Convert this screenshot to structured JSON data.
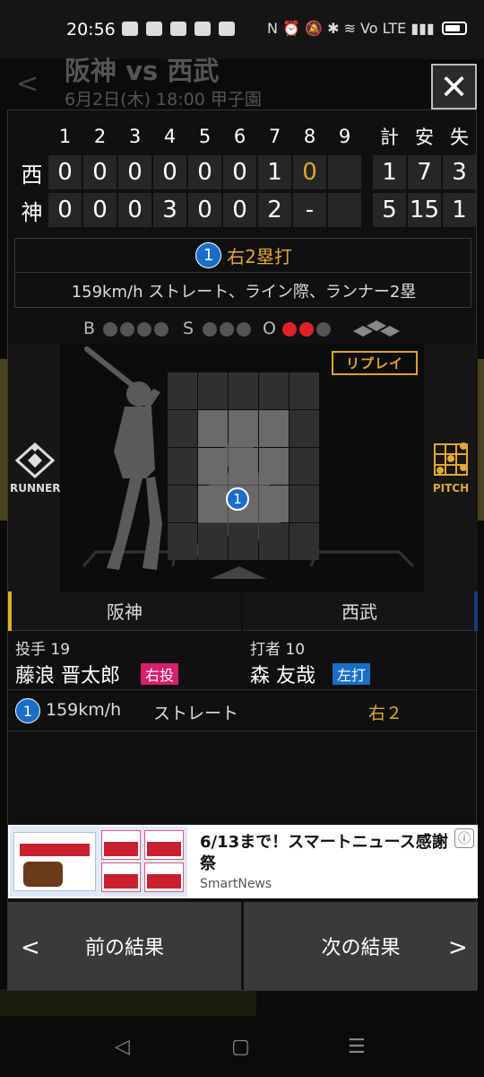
{
  "status": {
    "time": "20:56",
    "right": "N ⏰ 🔕 ✱ ≋ Vo LTE ▮▮▮"
  },
  "bg": {
    "title": "阪神 vs 西武",
    "subtitle": "6月2日(木) 18:00 甲子園",
    "back": "<"
  },
  "close": "✕",
  "scoreboard": {
    "innings": [
      "1",
      "2",
      "3",
      "4",
      "5",
      "6",
      "7",
      "8",
      "9"
    ],
    "totals": [
      "計",
      "安",
      "失"
    ],
    "rows": [
      {
        "team": "西",
        "scores": [
          "0",
          "0",
          "0",
          "0",
          "0",
          "0",
          "1",
          "0",
          ""
        ],
        "current_index": 7,
        "totals": [
          "1",
          "7",
          "3"
        ]
      },
      {
        "team": "神",
        "scores": [
          "0",
          "0",
          "0",
          "3",
          "0",
          "0",
          "2",
          "-",
          ""
        ],
        "current_index": -1,
        "totals": [
          "5",
          "15",
          "1"
        ]
      }
    ]
  },
  "play": {
    "number": "1",
    "result": "右2塁打",
    "detail": "159km/h ストレート、ライン際、ランナー2塁"
  },
  "count": {
    "b_label": "B",
    "s_label": "S",
    "o_label": "O",
    "balls": 0,
    "strikes": 0,
    "outs": 2
  },
  "field": {
    "replay": "リプレイ",
    "runner": "RUNNER",
    "pitch": "PITCH",
    "pitch_number": "1"
  },
  "teams": {
    "home": "阪神",
    "away": "西武"
  },
  "pitcher": {
    "role": "投手 19",
    "name": "藤浪 晋太郎",
    "hand": "右投"
  },
  "batter": {
    "role": "打者 10",
    "name": "森 友哉",
    "hand": "左打"
  },
  "pitch_row": {
    "number": "1",
    "speed": "159km/h",
    "type": "ストレート",
    "result": "右２"
  },
  "ad": {
    "title": "6/13まで！スマートニュース感謝祭",
    "source": "SmartNews",
    "info": "ⓘ"
  },
  "nav": {
    "prev": "前の結果",
    "next": "次の結果",
    "prev_arrow": "<",
    "next_arrow": ">"
  },
  "sysnav": {
    "back": "◁",
    "home": "▢",
    "menu": "☰"
  }
}
